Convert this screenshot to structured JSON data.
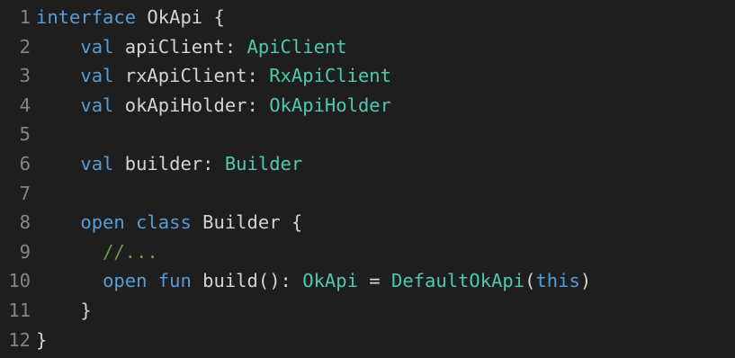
{
  "colors": {
    "background": "#1e1e1e",
    "line_number": "#858585",
    "keyword": "#569cd6",
    "type": "#4ec9b0",
    "comment": "#6a9955",
    "plain": "#d4d4d4"
  },
  "lines": [
    {
      "num": "1",
      "tokens": [
        {
          "text": "interface",
          "cls": "kw"
        },
        {
          "text": " OkApi {",
          "cls": "plain"
        }
      ]
    },
    {
      "num": "2",
      "tokens": [
        {
          "text": "    ",
          "cls": "plain"
        },
        {
          "text": "val",
          "cls": "kw"
        },
        {
          "text": " apiClient: ",
          "cls": "plain"
        },
        {
          "text": "ApiClient",
          "cls": "ty"
        }
      ]
    },
    {
      "num": "3",
      "tokens": [
        {
          "text": "    ",
          "cls": "plain"
        },
        {
          "text": "val",
          "cls": "kw"
        },
        {
          "text": " rxApiClient: ",
          "cls": "plain"
        },
        {
          "text": "RxApiClient",
          "cls": "ty"
        }
      ]
    },
    {
      "num": "4",
      "tokens": [
        {
          "text": "    ",
          "cls": "plain"
        },
        {
          "text": "val",
          "cls": "kw"
        },
        {
          "text": " okApiHolder: ",
          "cls": "plain"
        },
        {
          "text": "OkApiHolder",
          "cls": "ty"
        }
      ]
    },
    {
      "num": "5",
      "tokens": []
    },
    {
      "num": "6",
      "tokens": [
        {
          "text": "    ",
          "cls": "plain"
        },
        {
          "text": "val",
          "cls": "kw"
        },
        {
          "text": " builder: ",
          "cls": "plain"
        },
        {
          "text": "Builder",
          "cls": "ty"
        }
      ]
    },
    {
      "num": "7",
      "tokens": []
    },
    {
      "num": "8",
      "tokens": [
        {
          "text": "    ",
          "cls": "plain"
        },
        {
          "text": "open class",
          "cls": "kw"
        },
        {
          "text": " Builder {",
          "cls": "plain"
        }
      ]
    },
    {
      "num": "9",
      "tokens": [
        {
          "text": "      ",
          "cls": "plain"
        },
        {
          "text": "//...",
          "cls": "cmt"
        }
      ]
    },
    {
      "num": "10",
      "tokens": [
        {
          "text": "      ",
          "cls": "plain"
        },
        {
          "text": "open fun",
          "cls": "kw"
        },
        {
          "text": " build(): ",
          "cls": "plain"
        },
        {
          "text": "OkApi",
          "cls": "ty"
        },
        {
          "text": " = ",
          "cls": "plain"
        },
        {
          "text": "DefaultOkApi",
          "cls": "ty"
        },
        {
          "text": "(",
          "cls": "plain"
        },
        {
          "text": "this",
          "cls": "kw"
        },
        {
          "text": ")",
          "cls": "plain"
        }
      ]
    },
    {
      "num": "11",
      "tokens": [
        {
          "text": "    }",
          "cls": "plain"
        }
      ]
    },
    {
      "num": "12",
      "tokens": [
        {
          "text": "}",
          "cls": "plain"
        }
      ]
    }
  ]
}
